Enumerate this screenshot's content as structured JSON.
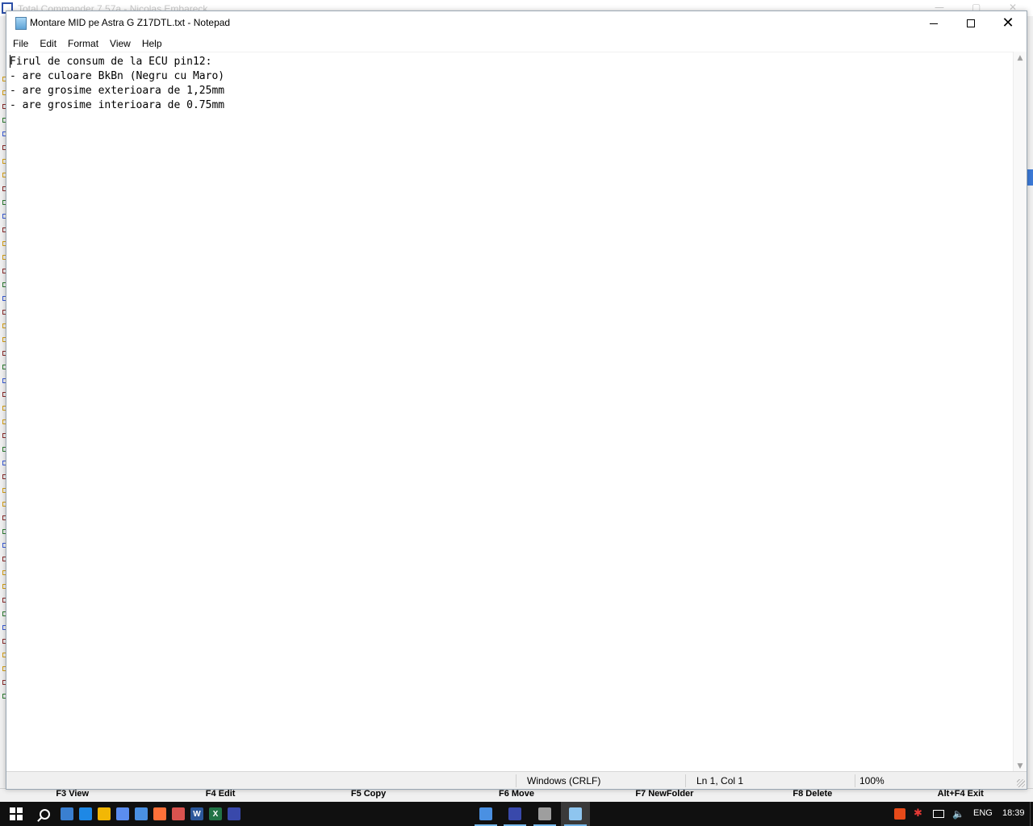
{
  "background_window": {
    "title": "Total Commander 7.57a - Nicolas Embareck",
    "function_keys": [
      "F3 View",
      "F4 Edit",
      "F5 Copy",
      "F6 Move",
      "F7 NewFolder",
      "F8 Delete",
      "Alt+F4 Exit"
    ]
  },
  "notepad": {
    "title": "Montare MID pe Astra G Z17DTL.txt - Notepad",
    "icon": "notepad-icon",
    "controls": {
      "minimize_icon": "minimize-icon",
      "maximize_icon": "maximize-icon",
      "close_icon": "close-icon"
    },
    "menu": [
      "File",
      "Edit",
      "Format",
      "View",
      "Help"
    ],
    "content_lines": [
      "Firul de consum de la ECU pin12:",
      "- are culoare BkBn (Negru cu Maro)",
      "- are grosime exterioara de 1,25mm",
      "- are grosime interioara de 0.75mm"
    ],
    "status": {
      "line_ending": "Windows (CRLF)",
      "position": "Ln 1, Col 1",
      "zoom": "100%"
    }
  },
  "taskbar": {
    "pinned": [
      {
        "name": "windows-explorer-icon",
        "color": "#3a7fd0"
      },
      {
        "name": "desktop-icon",
        "color": "#1e88e5"
      },
      {
        "name": "tools-icon",
        "color": "#f2b705"
      },
      {
        "name": "arrow-app-icon",
        "color": "#5b8def"
      },
      {
        "name": "globe-icon",
        "color": "#4a90e2"
      },
      {
        "name": "firefox-icon",
        "color": "#ff7139"
      },
      {
        "name": "calculator-icon",
        "color": "#d9534f"
      },
      {
        "name": "word-icon",
        "color": "#2b579a",
        "letter": "W"
      },
      {
        "name": "excel-icon",
        "color": "#217346",
        "letter": "X"
      },
      {
        "name": "save-app-icon",
        "color": "#3949ab"
      }
    ],
    "running": [
      {
        "name": "running-globe-icon",
        "color": "#4a90e2",
        "active": false
      },
      {
        "name": "running-floppy-icon",
        "color": "#3949ab",
        "active": false
      },
      {
        "name": "running-paint-icon",
        "color": "#9e9e9e",
        "active": false
      },
      {
        "name": "running-notepad-icon",
        "color": "#8ec5ef",
        "active": true
      }
    ],
    "tray": {
      "language": "ENG",
      "clock": "18:39"
    }
  },
  "colors": {
    "taskbar": "#101010",
    "accent": "#76b9ed",
    "status_bar": "#f0f0f0"
  }
}
